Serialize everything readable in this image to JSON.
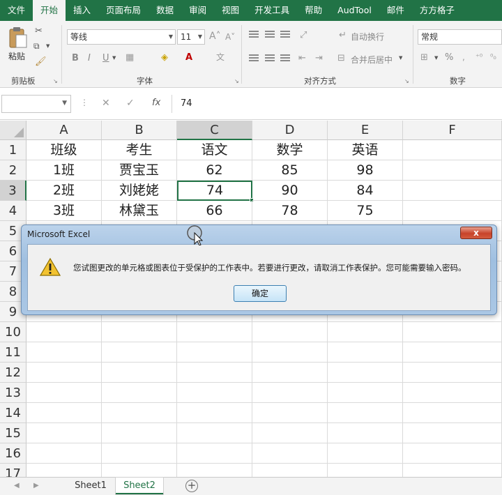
{
  "ribbon": {
    "tabs": [
      "文件",
      "开始",
      "插入",
      "页面布局",
      "数据",
      "审阅",
      "视图",
      "开发工具",
      "帮助",
      "AudTool",
      "邮件",
      "方方格子"
    ],
    "active_tab": "开始",
    "clipboard": {
      "paste_label": "粘贴",
      "group_label": "剪贴板"
    },
    "font": {
      "font_name": "等线",
      "font_size": "11",
      "group_label": "字体",
      "bold": "B",
      "italic": "I",
      "underline": "U"
    },
    "alignment": {
      "wrap_text": "自动换行",
      "merge_center": "合并后居中",
      "group_label": "对齐方式"
    },
    "number": {
      "format": "常规",
      "group_label": "数字",
      "percent": "%"
    }
  },
  "formula_bar": {
    "name_box": "",
    "fx_label": "fx",
    "value": "74"
  },
  "grid": {
    "columns": [
      "A",
      "B",
      "C",
      "D",
      "E",
      "F"
    ],
    "rows": [
      "1",
      "2",
      "3",
      "4",
      "5",
      "6",
      "7",
      "8",
      "9",
      "10",
      "11",
      "12",
      "13",
      "14",
      "15",
      "16",
      "17"
    ],
    "cells": [
      [
        "班级",
        "考生",
        "语文",
        "数学",
        "英语",
        ""
      ],
      [
        "1班",
        "贾宝玉",
        "62",
        "85",
        "98",
        ""
      ],
      [
        "2班",
        "刘姥姥",
        "74",
        "90",
        "84",
        ""
      ],
      [
        "3班",
        "林黛玉",
        "66",
        "78",
        "75",
        ""
      ],
      [
        "",
        "",
        "",
        "",
        "",
        ""
      ],
      [
        "",
        "",
        "",
        "",
        "",
        ""
      ],
      [
        "",
        "",
        "",
        "",
        "",
        ""
      ],
      [
        "",
        "",
        "",
        "",
        "",
        ""
      ],
      [
        "",
        "",
        "",
        "",
        "",
        ""
      ]
    ],
    "active_cell": "C3"
  },
  "sheets": [
    "Sheet1",
    "Sheet2"
  ],
  "active_sheet": "Sheet2",
  "dialog": {
    "title": "Microsoft Excel",
    "close_label": "x",
    "message": "您试图更改的单元格或图表位于受保护的工作表中。若要进行更改，请取消工作表保护。您可能需要输入密码。",
    "ok_label": "确定"
  },
  "colors": {
    "accent": "#217346",
    "dialog_frame": "#9fbfe0"
  }
}
